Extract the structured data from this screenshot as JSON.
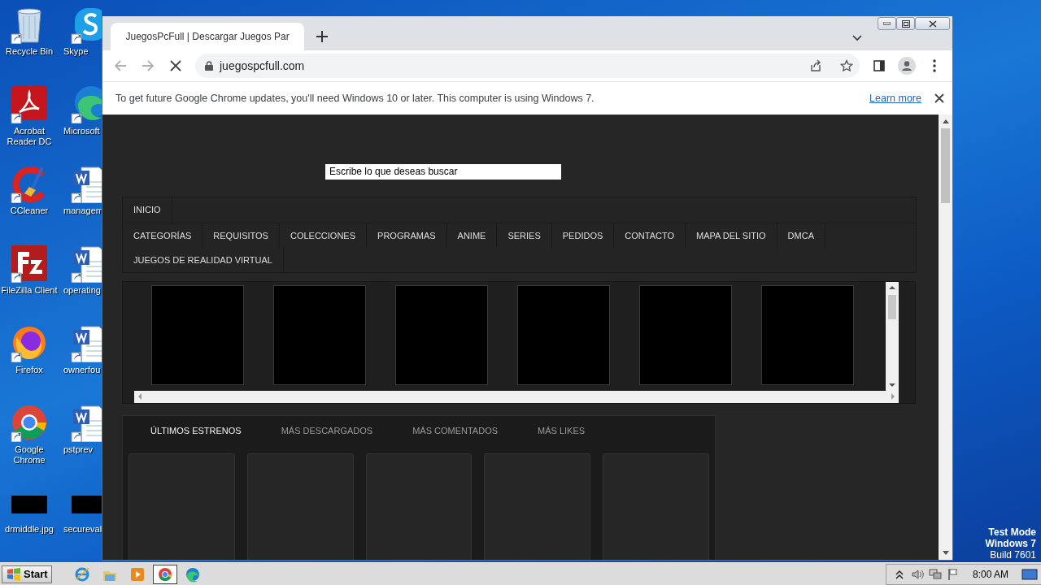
{
  "desktop": {
    "icons": [
      {
        "label": "Recycle Bin",
        "kind": "recycle"
      },
      {
        "label": "Skype",
        "kind": "skype"
      },
      {
        "label": "Acrobat Reader DC",
        "kind": "acrobat"
      },
      {
        "label": "Microsoft",
        "kind": "edge"
      },
      {
        "label": "CCleaner",
        "kind": "ccleaner"
      },
      {
        "label": "managem",
        "kind": "word"
      },
      {
        "label": "FileZilla Client",
        "kind": "filezilla"
      },
      {
        "label": "operating",
        "kind": "word"
      },
      {
        "label": "Firefox",
        "kind": "firefox"
      },
      {
        "label": "ownerfou",
        "kind": "word"
      },
      {
        "label": "Google Chrome",
        "kind": "chrome"
      },
      {
        "label": "pstprev",
        "kind": "word"
      },
      {
        "label": "drmiddle.jpg",
        "kind": "image"
      },
      {
        "label": "secureval",
        "kind": "image"
      }
    ],
    "watermark_lines": [
      "Test Mode",
      "Windows 7",
      "Build 7601"
    ]
  },
  "browser": {
    "tabs": [
      {
        "title": "JuegosPcFull | Descargar Juegos Par",
        "selected": true,
        "loading": true
      }
    ],
    "address": "juegospcfull.com",
    "infobar": {
      "message": "To get future Google Chrome updates, you'll need Windows 10 or later. This computer is using Windows 7.",
      "link": "Learn more"
    }
  },
  "page": {
    "search": {
      "value": "Escribe lo que deseas buscar"
    },
    "nav": {
      "rows": [
        {
          "items": [
            "INICIO"
          ]
        },
        {
          "items": [
            "CATEGORÍAS",
            "REQUISITOS",
            "COLECCIONES",
            "PROGRAMAS",
            "ANIME",
            "SERIES",
            "PEDIDOS",
            "CONTACTO",
            "MAPA DEL SITIO",
            "DMCA"
          ]
        },
        {
          "items": [
            "JUEGOS DE REALIDAD VIRTUAL"
          ]
        }
      ]
    },
    "carousel": {
      "thumbnails": [
        {
          "kind": "blank"
        },
        {
          "kind": "blank"
        },
        {
          "kind": "blank"
        },
        {
          "kind": "blank"
        },
        {
          "kind": "blank"
        },
        {
          "kind": "blank"
        }
      ]
    },
    "tabs": [
      {
        "label": "ÚLTIMOS ESTRENOS",
        "selected": true
      },
      {
        "label": "MÁS DESCARGADOS",
        "selected": false
      },
      {
        "label": "MÁS COMENTADOS",
        "selected": false
      },
      {
        "label": "MÁS LIKES",
        "selected": false
      }
    ],
    "cards": [
      {
        "kind": "blank"
      },
      {
        "kind": "blank"
      },
      {
        "kind": "blank"
      },
      {
        "kind": "blank"
      },
      {
        "kind": "blank"
      }
    ]
  },
  "taskbar": {
    "start": "Start",
    "apps": [
      {
        "kind": "ie",
        "selected": false
      },
      {
        "kind": "explorer",
        "selected": false
      },
      {
        "kind": "media",
        "selected": false
      },
      {
        "kind": "chrome",
        "selected": true
      },
      {
        "kind": "edge",
        "selected": false
      }
    ],
    "clock": "8:00 AM"
  }
}
